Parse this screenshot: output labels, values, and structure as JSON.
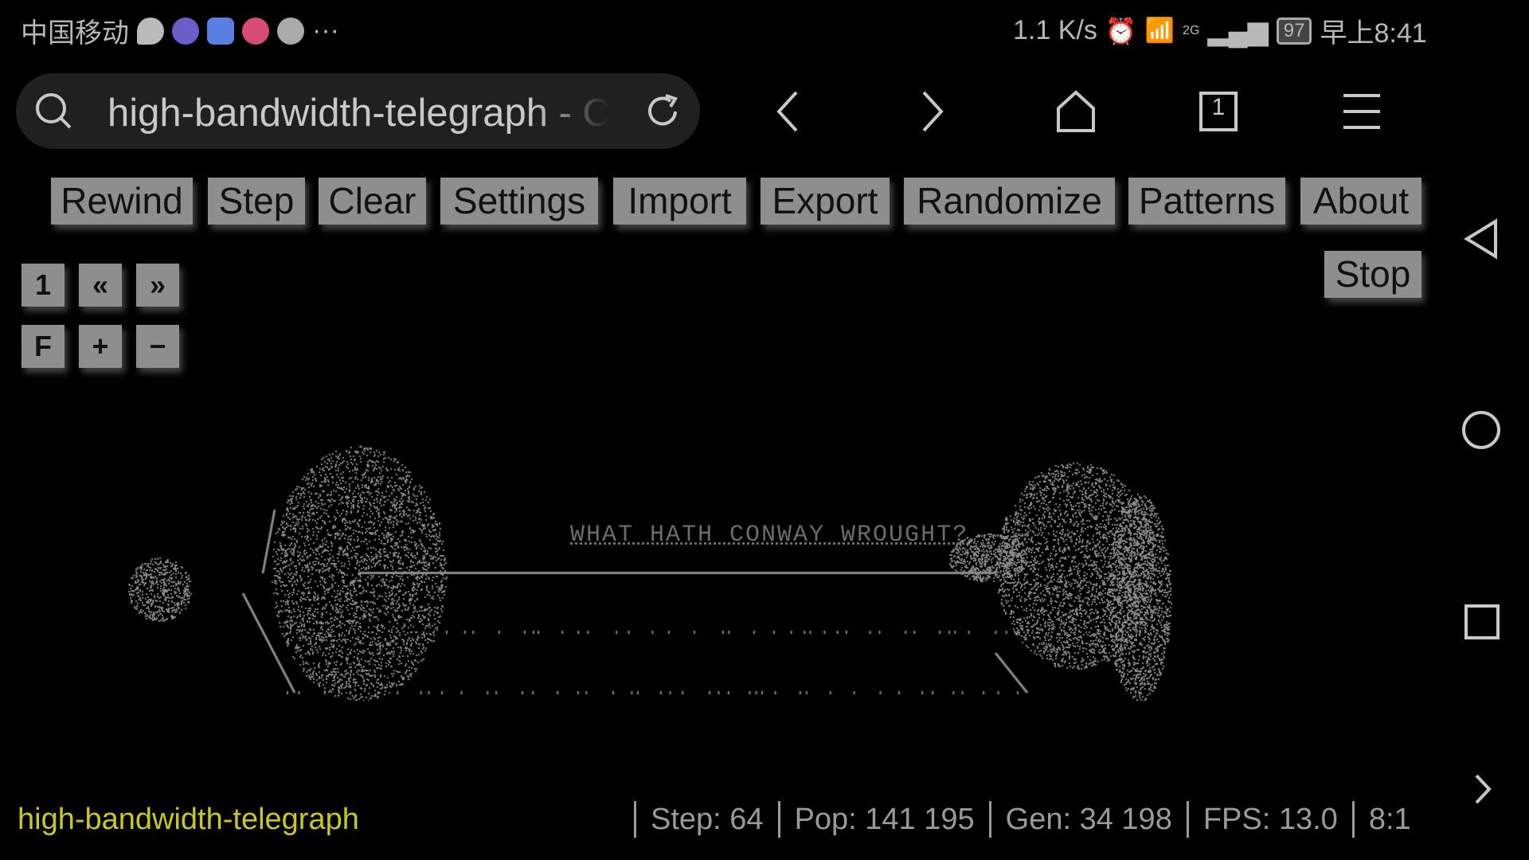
{
  "status_bar": {
    "carrier": "中国移动",
    "more": "···",
    "net_speed": "1.1 K/s",
    "network": "2G",
    "battery": "97",
    "time": "早上8:41"
  },
  "browser": {
    "url_text": "high-bandwidth-telegraph - Conway's Game of Life",
    "icons": [
      "search-icon",
      "reload-icon",
      "back-icon",
      "forward-icon",
      "home-icon",
      "tabs-icon",
      "menu-icon"
    ],
    "tab_count": "1"
  },
  "toolbar": {
    "buttons": [
      "Rewind",
      "Step",
      "Clear",
      "Settings",
      "Import",
      "Export",
      "Randomize",
      "Patterns",
      "About"
    ],
    "run_button": "Stop"
  },
  "side_controls": {
    "row1": [
      "1",
      "«",
      "»"
    ],
    "row2": [
      "F",
      "+",
      "−"
    ]
  },
  "pattern": {
    "embedded_text": "WHAT HATH CONWAY WROUGHT?",
    "color": "#8a8a8a"
  },
  "footer": {
    "pattern_name": "high-bandwidth-telegraph",
    "name_color": "#c8c81e",
    "step": "Step: 64",
    "population": "Pop:  141 195",
    "generation": "Gen: 34 198",
    "fps": "FPS: 13.0",
    "zoom": "8:1"
  },
  "system_nav": [
    "back-triangle-icon",
    "home-circle-icon",
    "recents-square-icon",
    "expand-chevron-icon"
  ]
}
